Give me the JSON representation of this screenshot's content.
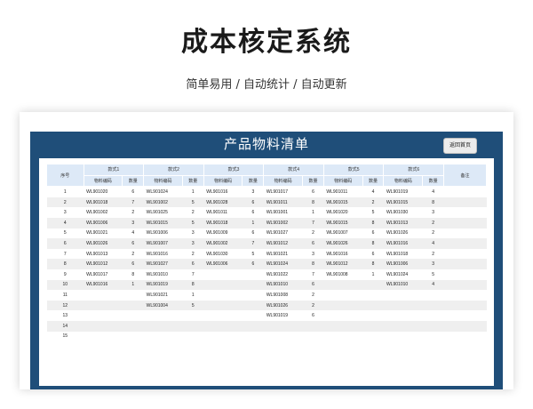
{
  "hero": {
    "title": "成本核定系统",
    "subtitle": "简单易用  /  自动统计  /  自动更新"
  },
  "panel": {
    "title": "产品物料清单",
    "home_button": "返回首页"
  },
  "table": {
    "headers": {
      "seq": "序号",
      "remark": "备注",
      "styles": [
        "款式1",
        "款式2",
        "款式3",
        "款式4",
        "款式5",
        "款式6"
      ],
      "code": "物料编码",
      "qty": "数量"
    },
    "rows": [
      {
        "no": "1",
        "cells": [
          [
            "WL901020",
            "6"
          ],
          [
            "WL901024",
            "1"
          ],
          [
            "WL901016",
            "3"
          ],
          [
            "WL901017",
            "6"
          ],
          [
            "WL901011",
            "4"
          ],
          [
            "WL901019",
            "4"
          ]
        ]
      },
      {
        "no": "2",
        "cells": [
          [
            "WL901018",
            "7"
          ],
          [
            "WL901002",
            "5"
          ],
          [
            "WL901028",
            "6"
          ],
          [
            "WL901011",
            "8"
          ],
          [
            "WL901015",
            "2"
          ],
          [
            "WL901015",
            "8"
          ]
        ]
      },
      {
        "no": "3",
        "cells": [
          [
            "WL901002",
            "2"
          ],
          [
            "WL901025",
            "2"
          ],
          [
            "WL901011",
            "6"
          ],
          [
            "WL901001",
            "1"
          ],
          [
            "WL901020",
            "5"
          ],
          [
            "WL901030",
            "3"
          ]
        ]
      },
      {
        "no": "4",
        "cells": [
          [
            "WL901006",
            "3"
          ],
          [
            "WL901015",
            "5"
          ],
          [
            "WL901018",
            "1"
          ],
          [
            "WL901002",
            "7"
          ],
          [
            "WL901015",
            "8"
          ],
          [
            "WL901013",
            "2"
          ]
        ]
      },
      {
        "no": "5",
        "cells": [
          [
            "WL901021",
            "4"
          ],
          [
            "WL901006",
            "3"
          ],
          [
            "WL901009",
            "6"
          ],
          [
            "WL901027",
            "2"
          ],
          [
            "WL901007",
            "6"
          ],
          [
            "WL901026",
            "2"
          ]
        ]
      },
      {
        "no": "6",
        "cells": [
          [
            "WL901026",
            "6"
          ],
          [
            "WL901007",
            "3"
          ],
          [
            "WL901002",
            "7"
          ],
          [
            "WL901012",
            "6"
          ],
          [
            "WL901026",
            "8"
          ],
          [
            "WL901016",
            "4"
          ]
        ]
      },
      {
        "no": "7",
        "cells": [
          [
            "WL901013",
            "2"
          ],
          [
            "WL901016",
            "2"
          ],
          [
            "WL901030",
            "5"
          ],
          [
            "WL901021",
            "3"
          ],
          [
            "WL901016",
            "6"
          ],
          [
            "WL901018",
            "2"
          ]
        ]
      },
      {
        "no": "8",
        "cells": [
          [
            "WL901012",
            "6"
          ],
          [
            "WL901027",
            "6"
          ],
          [
            "WL901006",
            "6"
          ],
          [
            "WL901024",
            "8"
          ],
          [
            "WL901012",
            "8"
          ],
          [
            "WL901006",
            "3"
          ]
        ]
      },
      {
        "no": "9",
        "cells": [
          [
            "WL901017",
            "8"
          ],
          [
            "WL901010",
            "7"
          ],
          [
            "",
            ""
          ],
          [
            "WL901022",
            "7"
          ],
          [
            "WL901008",
            "1"
          ],
          [
            "WL901024",
            "5"
          ]
        ]
      },
      {
        "no": "10",
        "cells": [
          [
            "WL901016",
            "1"
          ],
          [
            "WL901019",
            "8"
          ],
          [
            "",
            ""
          ],
          [
            "WL901010",
            "6"
          ],
          [
            "",
            ""
          ],
          [
            "WL901010",
            "4"
          ]
        ]
      },
      {
        "no": "11",
        "cells": [
          [
            "",
            ""
          ],
          [
            "WL901021",
            "1"
          ],
          [
            "",
            ""
          ],
          [
            "WL901008",
            "2"
          ],
          [
            "",
            ""
          ],
          [
            "",
            ""
          ]
        ]
      },
      {
        "no": "12",
        "cells": [
          [
            "",
            ""
          ],
          [
            "WL901004",
            "5"
          ],
          [
            "",
            ""
          ],
          [
            "WL901026",
            "2"
          ],
          [
            "",
            ""
          ],
          [
            "",
            ""
          ]
        ]
      },
      {
        "no": "13",
        "cells": [
          [
            "",
            ""
          ],
          [
            "",
            ""
          ],
          [
            "",
            ""
          ],
          [
            "WL901019",
            "6"
          ],
          [
            "",
            ""
          ],
          [
            "",
            ""
          ]
        ]
      },
      {
        "no": "14",
        "cells": [
          [
            "",
            ""
          ],
          [
            "",
            ""
          ],
          [
            "",
            ""
          ],
          [
            "",
            ""
          ],
          [
            "",
            ""
          ],
          [
            "",
            ""
          ]
        ]
      },
      {
        "no": "15",
        "cells": [
          [
            "",
            ""
          ],
          [
            "",
            ""
          ],
          [
            "",
            ""
          ],
          [
            "",
            ""
          ],
          [
            "",
            ""
          ],
          [
            "",
            ""
          ]
        ]
      }
    ]
  }
}
